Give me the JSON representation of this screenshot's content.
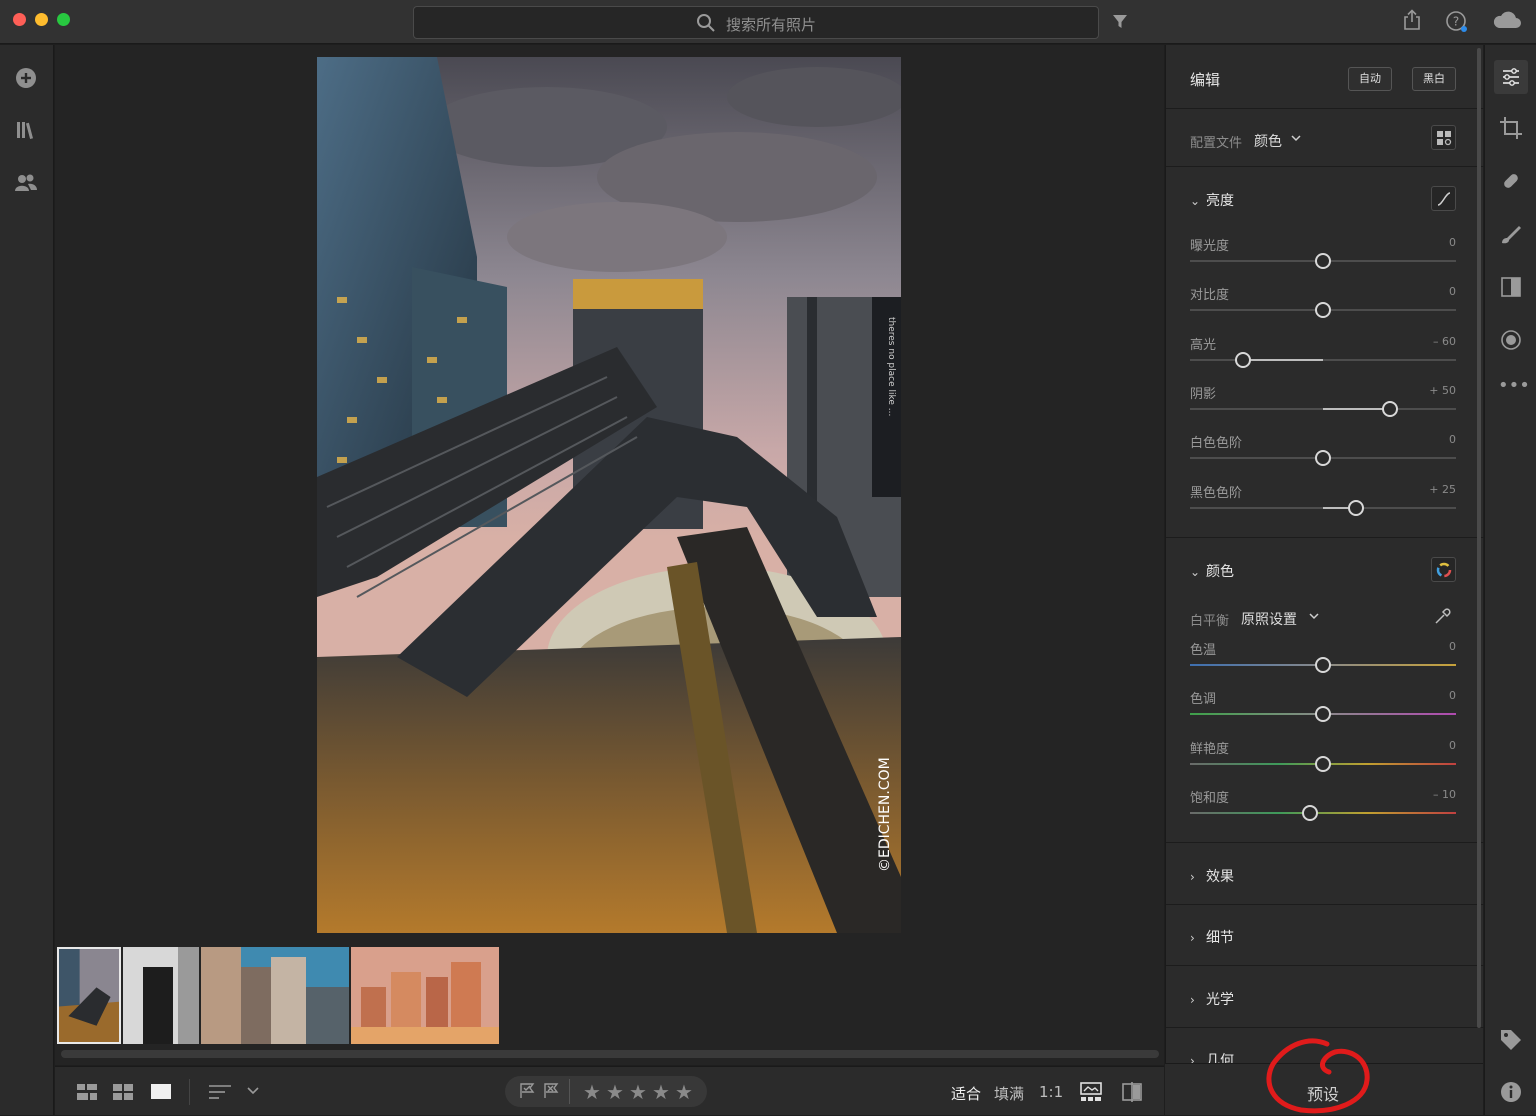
{
  "titlebar": {
    "search_placeholder": "搜索所有照片"
  },
  "icons": {
    "add": "add-icon",
    "library": "library-icon",
    "people": "people-icon",
    "filter": "filter-icon",
    "share": "share-icon",
    "help": "help-icon",
    "cloud": "cloud-icon"
  },
  "edit_panel": {
    "title": "编辑",
    "auto_label": "自动",
    "bw_label": "黑白",
    "profile_label": "配置文件",
    "profile_value": "颜色",
    "light": {
      "heading": "亮度",
      "sliders": [
        {
          "name": "曝光度",
          "value": "0",
          "level": 0
        },
        {
          "name": "对比度",
          "value": "0",
          "level": 0
        },
        {
          "name": "高光",
          "value": "– 60",
          "level": -60
        },
        {
          "name": "阴影",
          "value": "+ 50",
          "level": 50
        },
        {
          "name": "白色色阶",
          "value": "0",
          "level": 0
        },
        {
          "name": "黑色色阶",
          "value": "+ 25",
          "level": 25
        }
      ]
    },
    "color": {
      "heading": "颜色",
      "wb_label": "白平衡",
      "wb_value": "原照设置",
      "sliders": [
        {
          "name": "色温",
          "value": "0",
          "level": 0
        },
        {
          "name": "色调",
          "value": "0",
          "level": 0
        },
        {
          "name": "鲜艳度",
          "value": "0",
          "level": 0
        },
        {
          "name": "饱和度",
          "value": "– 10",
          "level": -10
        }
      ]
    },
    "sections": [
      "效果",
      "细节",
      "光学",
      "几何"
    ],
    "presets_label": "预设"
  },
  "bottombar": {
    "fit_label": "适合",
    "fill_label": "填满",
    "ratio_label": "1:1"
  },
  "photo": {
    "watermark": "©EDICHEN.COM",
    "sign_text": "theres no place like ..."
  },
  "colors": {
    "accent_annotation": "#e01b1b"
  }
}
